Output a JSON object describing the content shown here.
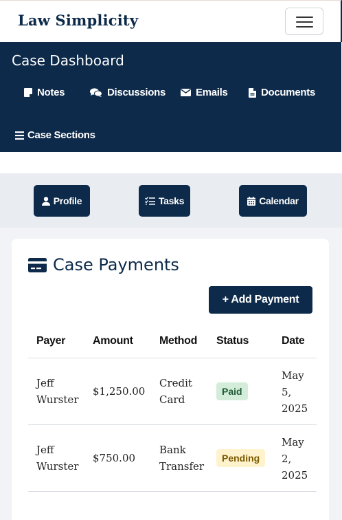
{
  "brand": "Law Simplicity",
  "dashboard": {
    "title": "Case Dashboard",
    "nav": [
      {
        "label": "Notes",
        "icon": "note-icon"
      },
      {
        "label": "Discussions",
        "icon": "comments-icon"
      },
      {
        "label": "Emails",
        "icon": "envelope-icon"
      },
      {
        "label": "Documents",
        "icon": "file-icon"
      },
      {
        "label": "Case Sections",
        "icon": "bars-icon"
      }
    ]
  },
  "quick_buttons": [
    {
      "label": "Profile",
      "icon": "user-icon"
    },
    {
      "label": "Tasks",
      "icon": "tasks-icon"
    },
    {
      "label": "Calendar",
      "icon": "calendar-icon"
    }
  ],
  "payments": {
    "title": "Case Payments",
    "add_label": "+ Add Payment",
    "columns": [
      "Payer",
      "Amount",
      "Method",
      "Status",
      "Date"
    ],
    "rows": [
      {
        "payer": "Jeff Wurster",
        "amount": "$1,250.00",
        "method": "Credit Card",
        "status": "Paid",
        "date": "May 5, 2025"
      },
      {
        "payer": "Jeff Wurster",
        "amount": "$750.00",
        "method": "Bank Transfer",
        "status": "Pending",
        "date": "May 2, 2025"
      }
    ]
  },
  "colors": {
    "primary": "#0d2a4a",
    "band": "#e9edf2",
    "paid_bg": "#d4edda",
    "pending_bg": "#fff3cd"
  }
}
